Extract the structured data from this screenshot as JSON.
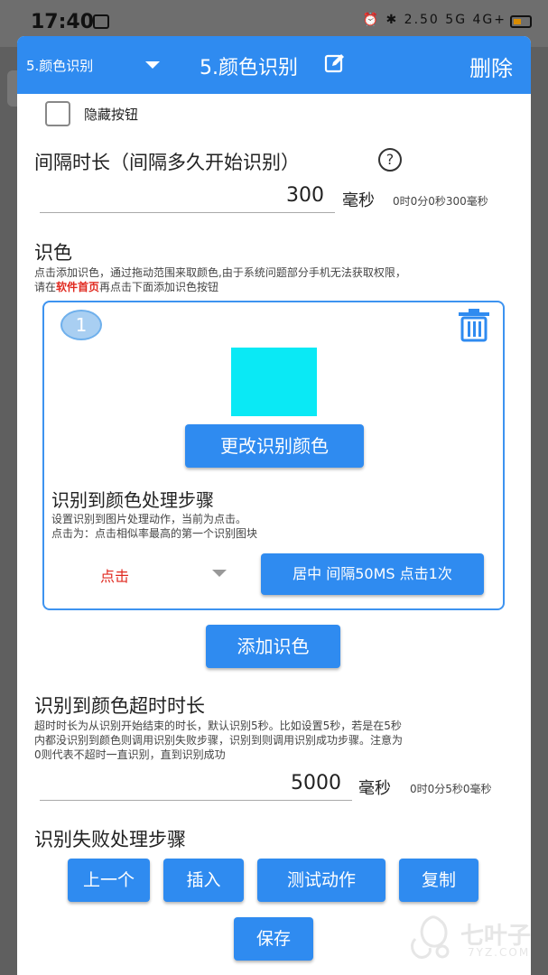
{
  "status_bar": {
    "time": "17:40",
    "icons_text": "⏰ ✱ 2.50 5G 4G+"
  },
  "header": {
    "selector_value": "5.颜色识别",
    "title": "5.颜色识别",
    "delete_label": "删除"
  },
  "hide_button": {
    "label": "隐藏按钮"
  },
  "interval": {
    "title": "间隔时长（间隔多久开始识别）",
    "help": "?",
    "value": "300",
    "unit": "毫秒",
    "readout": "0时0分0秒300毫秒"
  },
  "recognize": {
    "title": "识色",
    "desc_line1": "点击添加识色，通过拖动范围来取颜色,由于系统问题部分手机无法获取权限，",
    "desc_line2_prefix": "请在",
    "desc_line2_link": "软件首页",
    "desc_line2_suffix": "再点击下面添加识色按钮"
  },
  "color_card": {
    "index": "1",
    "swatch_color": "#0ae9f5",
    "change_button": "更改识别颜色",
    "step_title": "识别到颜色处理步骤",
    "step_desc1": "设置识别到图片处理动作，当前为点击。",
    "step_desc2": "点击为：点击相似率最高的第一个识别图块",
    "mode": "点击",
    "action_button": "居中 间隔50MS 点击1次"
  },
  "add_button": "添加识色",
  "timeout": {
    "title": "识别到颜色超时时长",
    "desc1": "超时时长为从识别开始结束的时长，默认识别5秒。比如设置5秒，若是在5秒",
    "desc2": "内都没识别到颜色则调用识别失败步骤，识别到则调用识别成功步骤。注意为",
    "desc3": "0则代表不超时一直识别，直到识别成功",
    "value": "5000",
    "unit": "毫秒",
    "readout": "0时0分5秒0毫秒"
  },
  "fail": {
    "title": "识别失败处理步骤"
  },
  "actions": {
    "prev": "上一个",
    "insert": "插入",
    "test": "测试动作",
    "copy": "复制",
    "save": "保存"
  },
  "watermark": {
    "text": "七叶子",
    "sub": "7YZ.COM"
  },
  "colors": {
    "accent": "#2f8bf0",
    "danger": "#e0291f"
  }
}
